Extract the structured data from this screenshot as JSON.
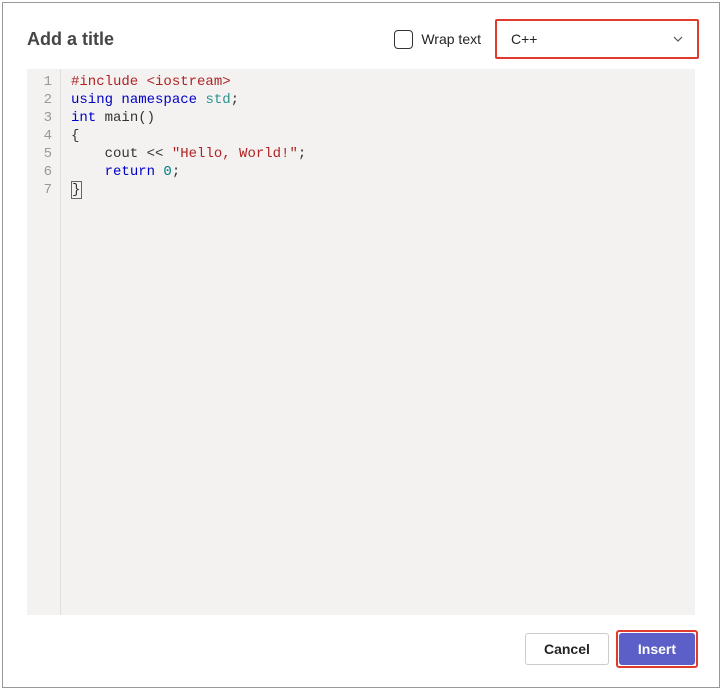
{
  "header": {
    "title_placeholder": "Add a title",
    "title_value": "",
    "wrap_label": "Wrap text",
    "language_selected": "C++"
  },
  "code": {
    "line_numbers": [
      "1",
      "2",
      "3",
      "4",
      "5",
      "6",
      "7"
    ],
    "lines": [
      [
        {
          "t": "#include ",
          "c": "tok-preproc"
        },
        {
          "t": "<iostream>",
          "c": "tok-preproc"
        }
      ],
      [
        {
          "t": "using ",
          "c": "tok-keyword"
        },
        {
          "t": "namespace ",
          "c": "tok-keyword"
        },
        {
          "t": "std",
          "c": "tok-ident"
        },
        {
          "t": ";",
          "c": "tok-punct"
        }
      ],
      [
        {
          "t": "int ",
          "c": "tok-type"
        },
        {
          "t": "main",
          "c": "tok-default"
        },
        {
          "t": "()",
          "c": "tok-punct"
        }
      ],
      [
        {
          "t": "{",
          "c": "tok-punct"
        }
      ],
      [
        {
          "t": "    cout ",
          "c": "tok-default"
        },
        {
          "t": "<< ",
          "c": "tok-punct"
        },
        {
          "t": "\"Hello, World!\"",
          "c": "tok-string"
        },
        {
          "t": ";",
          "c": "tok-punct"
        }
      ],
      [
        {
          "t": "    ",
          "c": "tok-default"
        },
        {
          "t": "return ",
          "c": "tok-keyword"
        },
        {
          "t": "0",
          "c": "tok-number"
        },
        {
          "t": ";",
          "c": "tok-punct"
        }
      ],
      [
        {
          "t": "}",
          "c": "tok-punct",
          "cursor": true
        }
      ]
    ]
  },
  "footer": {
    "cancel_label": "Cancel",
    "insert_label": "Insert"
  }
}
